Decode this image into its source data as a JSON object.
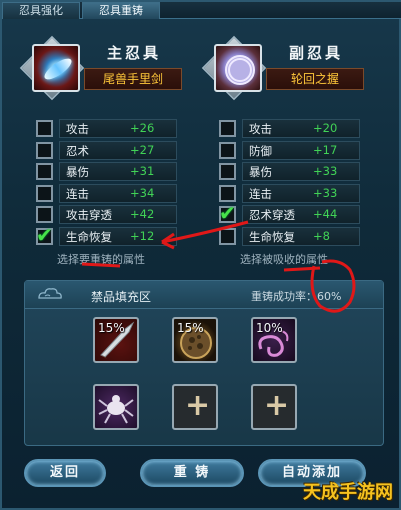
{
  "tabs": [
    {
      "label": "忍具强化",
      "active": false
    },
    {
      "label": "忍具重铸",
      "active": true
    }
  ],
  "main_tool": {
    "title": "主忍具",
    "name": "尾兽手里剑"
  },
  "sub_tool": {
    "title": "副忍具",
    "name": "轮回之握"
  },
  "main_attrs": [
    {
      "name": "攻击",
      "value": "+26",
      "checked": false
    },
    {
      "name": "忍术",
      "value": "+27",
      "checked": false
    },
    {
      "name": "暴伤",
      "value": "+31",
      "checked": false
    },
    {
      "name": "连击",
      "value": "+34",
      "checked": false
    },
    {
      "name": "攻击穿透",
      "value": "+42",
      "checked": false
    },
    {
      "name": "生命恢复",
      "value": "+12",
      "checked": true
    }
  ],
  "sub_attrs": [
    {
      "name": "攻击",
      "value": "+20",
      "checked": false
    },
    {
      "name": "防御",
      "value": "+17",
      "checked": false
    },
    {
      "name": "暴伤",
      "value": "+33",
      "checked": false
    },
    {
      "name": "连击",
      "value": "+33",
      "checked": false
    },
    {
      "name": "忍术穿透",
      "value": "+44",
      "checked": true
    },
    {
      "name": "生命恢复",
      "value": "+8",
      "checked": false
    }
  ],
  "hints": {
    "main": "选择要重铸的属性",
    "sub": "选择被吸收的属性"
  },
  "material": {
    "title": "禁品填充区",
    "rate": "重铸成功率：60%",
    "slots": [
      {
        "pct": "15%",
        "icon": "blade-icon"
      },
      {
        "pct": "15%",
        "icon": "rock-icon"
      },
      {
        "pct": "10%",
        "icon": "chain-icon"
      },
      {
        "pct": "",
        "icon": "spider-icon"
      },
      {
        "pct": "",
        "icon": "plus-icon"
      },
      {
        "pct": "",
        "icon": "plus-icon"
      }
    ]
  },
  "buttons": {
    "back": "返回",
    "reforge": "重 铸",
    "auto_add": "自动添加"
  },
  "watermark": "天成手游网",
  "colors": {
    "value_green": "#41d356",
    "name_gold": "#ffc83a",
    "annotation_red": "#e01818"
  }
}
